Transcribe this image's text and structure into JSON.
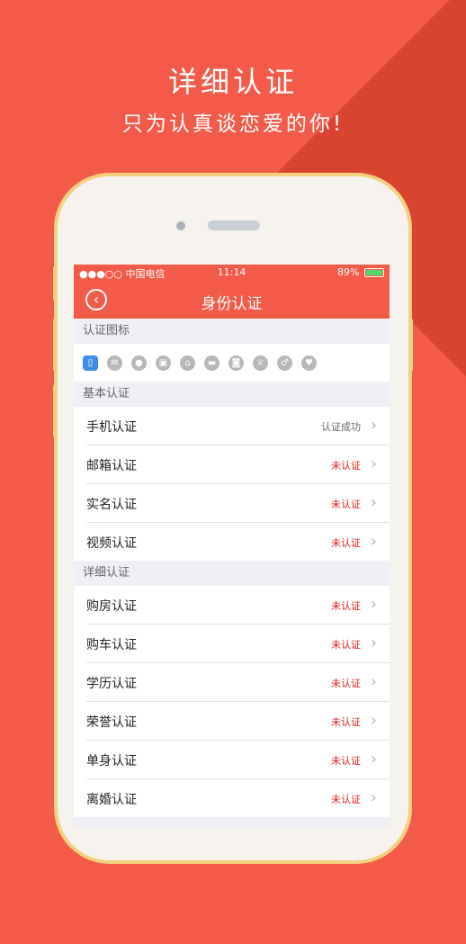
{
  "promo": {
    "title": "详细认证",
    "subtitle": "只为认真谈恋爱的你!"
  },
  "status_bar": {
    "carrier": "●●●○○ 中国电信",
    "time": "11:14",
    "battery": "89%"
  },
  "nav": {
    "back_icon": "back-circle-icon",
    "title": "身份认证"
  },
  "icons_section": {
    "header": "认证图标",
    "icons": [
      "phone-icon",
      "email-icon",
      "id-icon",
      "video-icon",
      "house-icon",
      "car-icon",
      "education-icon",
      "honor-icon",
      "single-icon",
      "divorce-icon"
    ]
  },
  "basic_section": {
    "header": "基本认证",
    "rows": [
      {
        "label": "手机认证",
        "status": "认证成功",
        "state": "ok"
      },
      {
        "label": "邮箱认证",
        "status": "未认证",
        "state": "no"
      },
      {
        "label": "实名认证",
        "status": "未认证",
        "state": "no"
      },
      {
        "label": "视频认证",
        "status": "未认证",
        "state": "no"
      }
    ]
  },
  "detail_section": {
    "header": "详细认证",
    "rows": [
      {
        "label": "购房认证",
        "status": "未认证",
        "state": "no"
      },
      {
        "label": "购车认证",
        "status": "未认证",
        "state": "no"
      },
      {
        "label": "学历认证",
        "status": "未认证",
        "state": "no"
      },
      {
        "label": "荣誉认证",
        "status": "未认证",
        "state": "no"
      },
      {
        "label": "单身认证",
        "status": "未认证",
        "state": "no"
      },
      {
        "label": "离婚认证",
        "status": "未认证",
        "state": "no"
      }
    ]
  },
  "colors": {
    "brand": "#f45a48",
    "pending": "#e02020",
    "phone_frame": "#f3d27f"
  }
}
